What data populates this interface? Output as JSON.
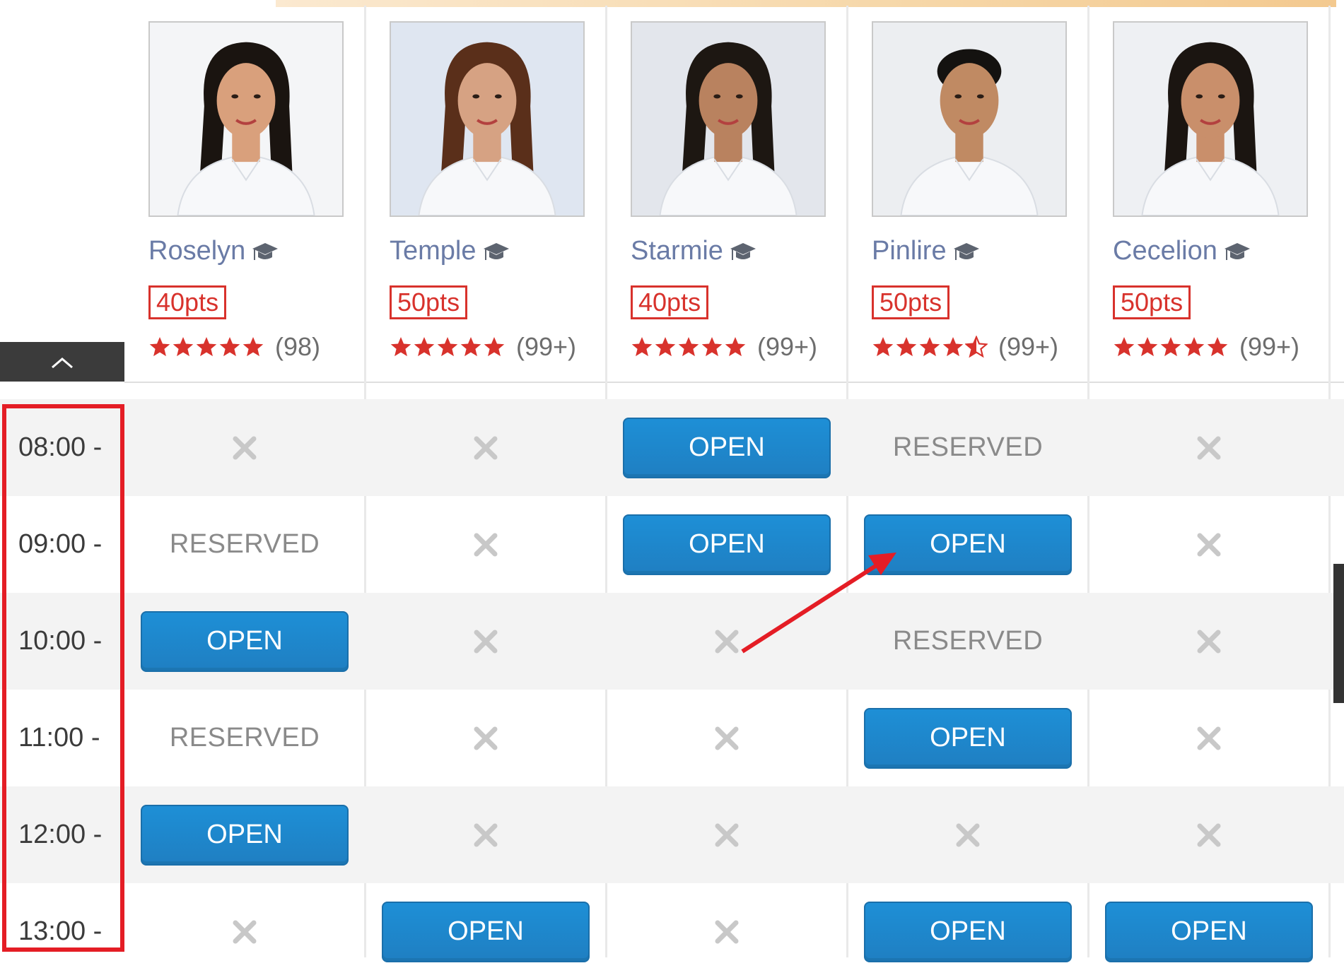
{
  "teachers": [
    {
      "name": "Roselyn",
      "points": "40pts",
      "rating": 5,
      "rating_count": "(98)"
    },
    {
      "name": "Temple",
      "points": "50pts",
      "rating": 5,
      "rating_count": "(99+)"
    },
    {
      "name": "Starmie",
      "points": "40pts",
      "rating": 5,
      "rating_count": "(99+)"
    },
    {
      "name": "Pinlire",
      "points": "50pts",
      "rating": 4.5,
      "rating_count": "(99+)"
    },
    {
      "name": "Cecelion",
      "points": "50pts",
      "rating": 5,
      "rating_count": "(99+)"
    }
  ],
  "slots": {
    "open_label": "OPEN",
    "reserved_label": "RESERVED",
    "rows": [
      {
        "time": "08:00 -",
        "cells": [
          "unavailable",
          "unavailable",
          "open",
          "reserved",
          "unavailable"
        ]
      },
      {
        "time": "09:00 -",
        "cells": [
          "reserved",
          "unavailable",
          "open",
          "open",
          "unavailable"
        ]
      },
      {
        "time": "10:00 -",
        "cells": [
          "open",
          "unavailable",
          "unavailable",
          "reserved",
          "unavailable"
        ]
      },
      {
        "time": "11:00 -",
        "cells": [
          "reserved",
          "unavailable",
          "unavailable",
          "open",
          "unavailable"
        ]
      },
      {
        "time": "12:00 -",
        "cells": [
          "open",
          "unavailable",
          "unavailable",
          "unavailable",
          "unavailable"
        ]
      },
      {
        "time": "13:00 -",
        "cells": [
          "unavailable",
          "open",
          "unavailable",
          "open",
          "open"
        ]
      }
    ]
  },
  "icons": {
    "collapse": "chevron-up-icon",
    "teacher_badge": "graduation-cap-icon",
    "unavailable": "x-icon",
    "rating": "star-icon"
  },
  "colors": {
    "open_button": "#1f85cc",
    "points_border": "#d8322c",
    "star": "#d8322c",
    "highlight": "#e41d25",
    "name": "#6a7ba6"
  }
}
